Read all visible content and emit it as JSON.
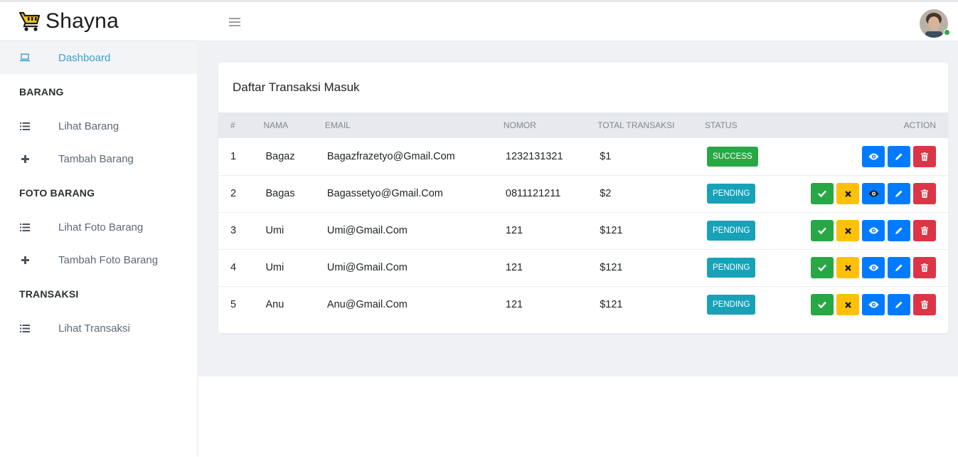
{
  "brand": {
    "name": "Shayna"
  },
  "sidebar": {
    "dashboard": "Dashboard",
    "sections": [
      {
        "heading": "BARANG",
        "items": [
          "Lihat Barang",
          "Tambah Barang"
        ]
      },
      {
        "heading": "FOTO BARANG",
        "items": [
          "Lihat Foto Barang",
          "Tambah Foto Barang"
        ]
      },
      {
        "heading": "TRANSAKSI",
        "items": [
          "Lihat Transaksi"
        ]
      }
    ]
  },
  "card": {
    "title": "Daftar Transaksi Masuk",
    "columns": [
      "#",
      "NAMA",
      "EMAIL",
      "NOMOR",
      "TOTAL TRANSAKSI",
      "STATUS",
      "ACTION"
    ],
    "rows": [
      {
        "num": "1",
        "name": "Bagaz",
        "email": "Bagazfrazetyo@Gmail.Com",
        "phone": "1232131321",
        "total": "$1",
        "status": "SUCCESS"
      },
      {
        "num": "2",
        "name": "Bagas",
        "email": "Bagassetyo@Gmail.Com",
        "phone": "0811121211",
        "total": "$2",
        "status": "PENDING"
      },
      {
        "num": "3",
        "name": "Umi",
        "email": "Umi@Gmail.Com",
        "phone": "121",
        "total": "$121",
        "status": "PENDING"
      },
      {
        "num": "4",
        "name": "Umi",
        "email": "Umi@Gmail.Com",
        "phone": "121",
        "total": "$121",
        "status": "PENDING"
      },
      {
        "num": "5",
        "name": "Anu",
        "email": "Anu@Gmail.Com",
        "phone": "121",
        "total": "$121",
        "status": "PENDING"
      }
    ]
  },
  "colors": {
    "success": "#28a745",
    "pending": "#17a2b8",
    "warning": "#ffc107",
    "primary": "#007bff",
    "danger": "#dc3545",
    "active_link": "#3a9fd6"
  },
  "icons": {
    "brand": "shopping-cart-icon",
    "menu": "hamburger-icon",
    "dashboard": "laptop-icon",
    "list": "list-icon",
    "add": "plus-icon",
    "approve": "check-icon",
    "reject": "x-icon",
    "view": "eye-icon",
    "edit": "pencil-icon",
    "delete": "trash-icon"
  }
}
